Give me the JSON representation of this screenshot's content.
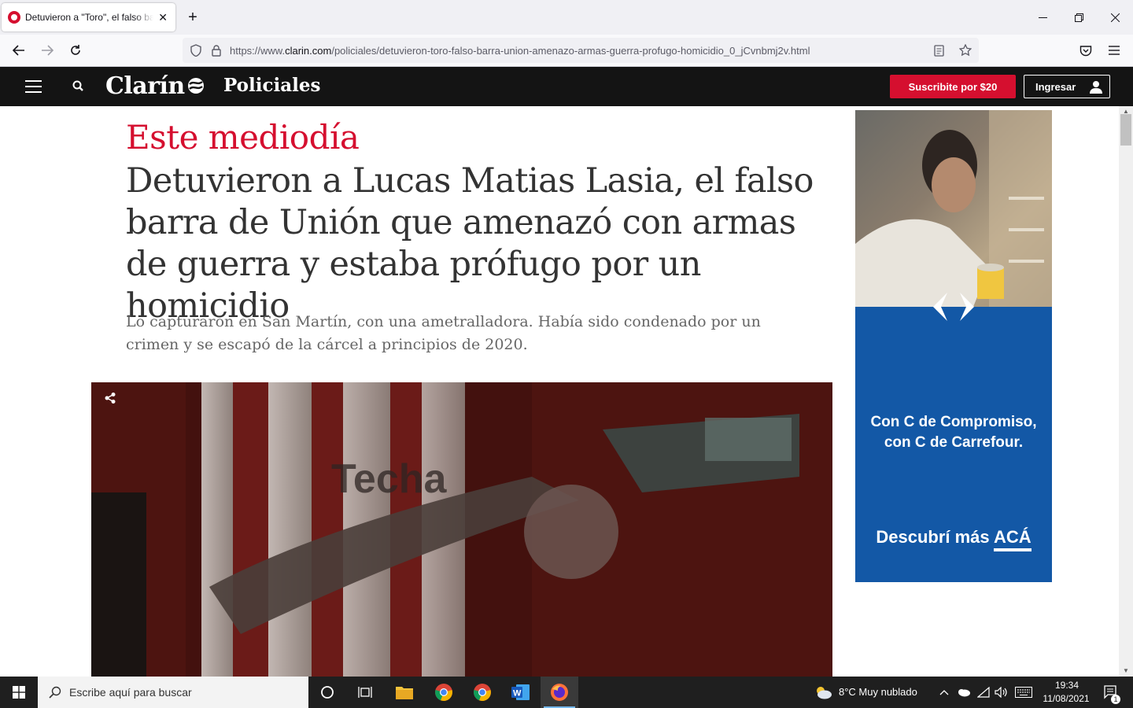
{
  "browser": {
    "tab_title": "Detuvieron a \"Toro\", el falso barra de Unión",
    "tab_close": "✕",
    "new_tab": "+",
    "url_prefix": "https://www.",
    "url_domain": "clarin.com",
    "url_path": "/policiales/detuvieron-toro-falso-barra-union-amenazo-armas-guerra-profugo-homicidio_0_jCvnbmj2v.html",
    "icons": [
      "back-icon",
      "forward-icon",
      "reload-icon",
      "shield-icon",
      "lock-icon",
      "reader-view-icon",
      "bookmark-star-icon",
      "pocket-icon",
      "menu-icon"
    ]
  },
  "site": {
    "logo": "Clarín",
    "section": "Policiales",
    "subscribe_label": "Suscribite por $20",
    "login_label": "Ingresar",
    "brand_color": "#d50f2f"
  },
  "article": {
    "kicker": "Este mediodía",
    "headline": "Detuvieron a Lucas Matias Lasia, el falso barra de Unión que amenazó con armas de guerra y estaba prófugo por un homicidio",
    "summary": "Lo capturaron en San Martín, con una ametralladora. Había sido condenado por un crimen y se escapó de la cárcel a principios de 2020."
  },
  "ad": {
    "line1": "Con C de Compromiso,",
    "line2": "con C de Carrefour.",
    "cta_prefix": "Descubrí más ",
    "cta_link": "ACÁ",
    "bg_color": "#1358a6"
  },
  "taskbar": {
    "search_placeholder": "Escribe aquí para buscar",
    "weather": "8°C  Muy nublado",
    "time": "19:34",
    "date": "11/08/2021",
    "notification_count": "1"
  }
}
